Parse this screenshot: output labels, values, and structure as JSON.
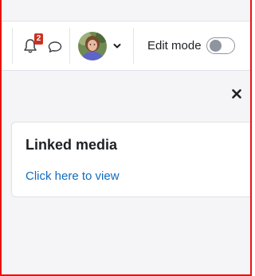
{
  "navbar": {
    "notifications": {
      "icon": "bell-icon",
      "count": "2",
      "badge_color": "#ca3120"
    },
    "messages": {
      "icon": "chat-bubble-icon"
    },
    "user_menu": {
      "avatar": "user-avatar",
      "caret": "chevron-down-icon"
    },
    "edit_mode": {
      "label": "Edit mode",
      "state": "off"
    }
  },
  "drawer": {
    "close_icon": "close-icon"
  },
  "block": {
    "title": "Linked media",
    "link_text": "Click here to view",
    "link_color": "#0f6cbf"
  }
}
